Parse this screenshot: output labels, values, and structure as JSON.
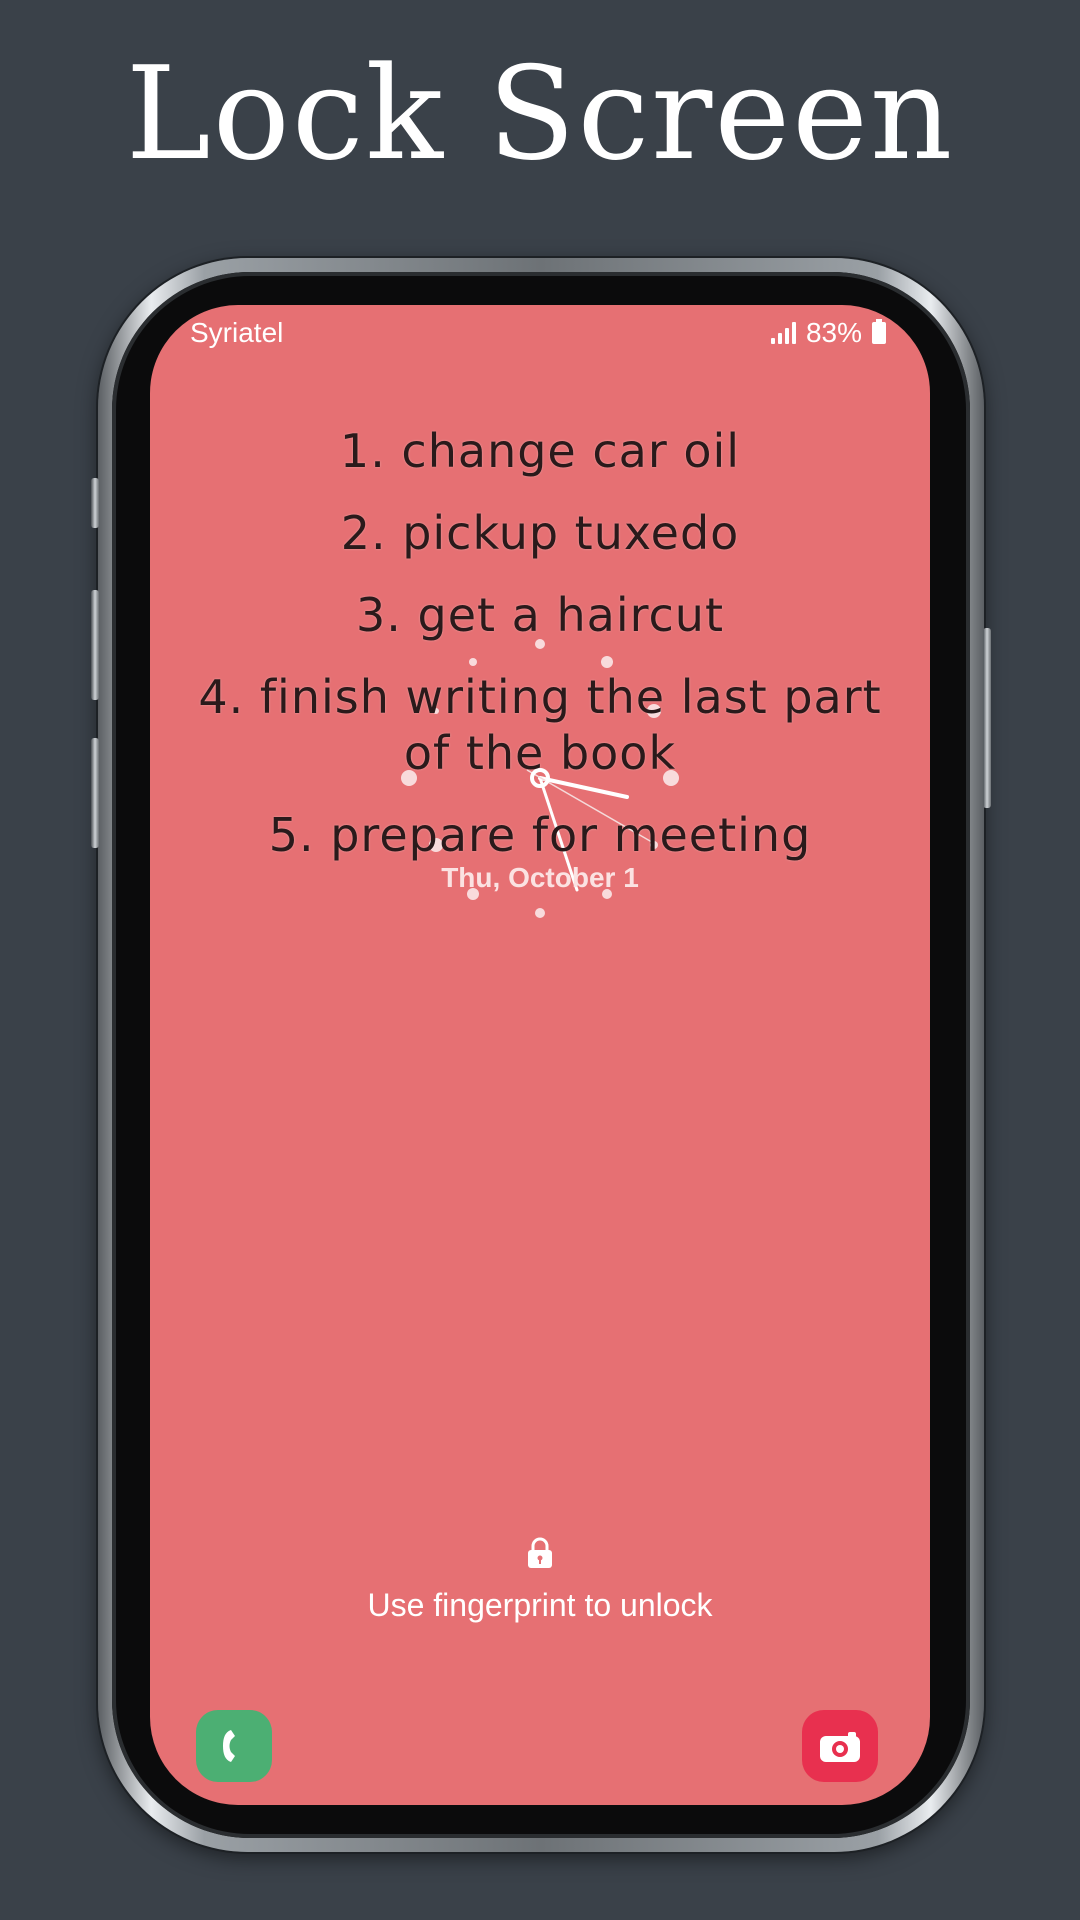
{
  "header": {
    "title": "Lock Screen"
  },
  "status_bar": {
    "carrier": "Syriatel",
    "battery": "83%"
  },
  "todos": [
    "1. change car oil",
    "2. pickup tuxedo",
    "3. get a haircut",
    "4. finish writing the last part of the book",
    "5. prepare for meeting"
  ],
  "date": "Thu, October 1",
  "unlock_hint": "Use fingerprint to unlock",
  "shortcuts": {
    "left": "phone-icon",
    "right": "camera-icon"
  },
  "colors": {
    "background": "#3a4149",
    "screen": "#e67073",
    "phone_shortcut": "#4caf73",
    "camera_shortcut": "#e8304f",
    "todo_text": "#2a1a1b"
  }
}
